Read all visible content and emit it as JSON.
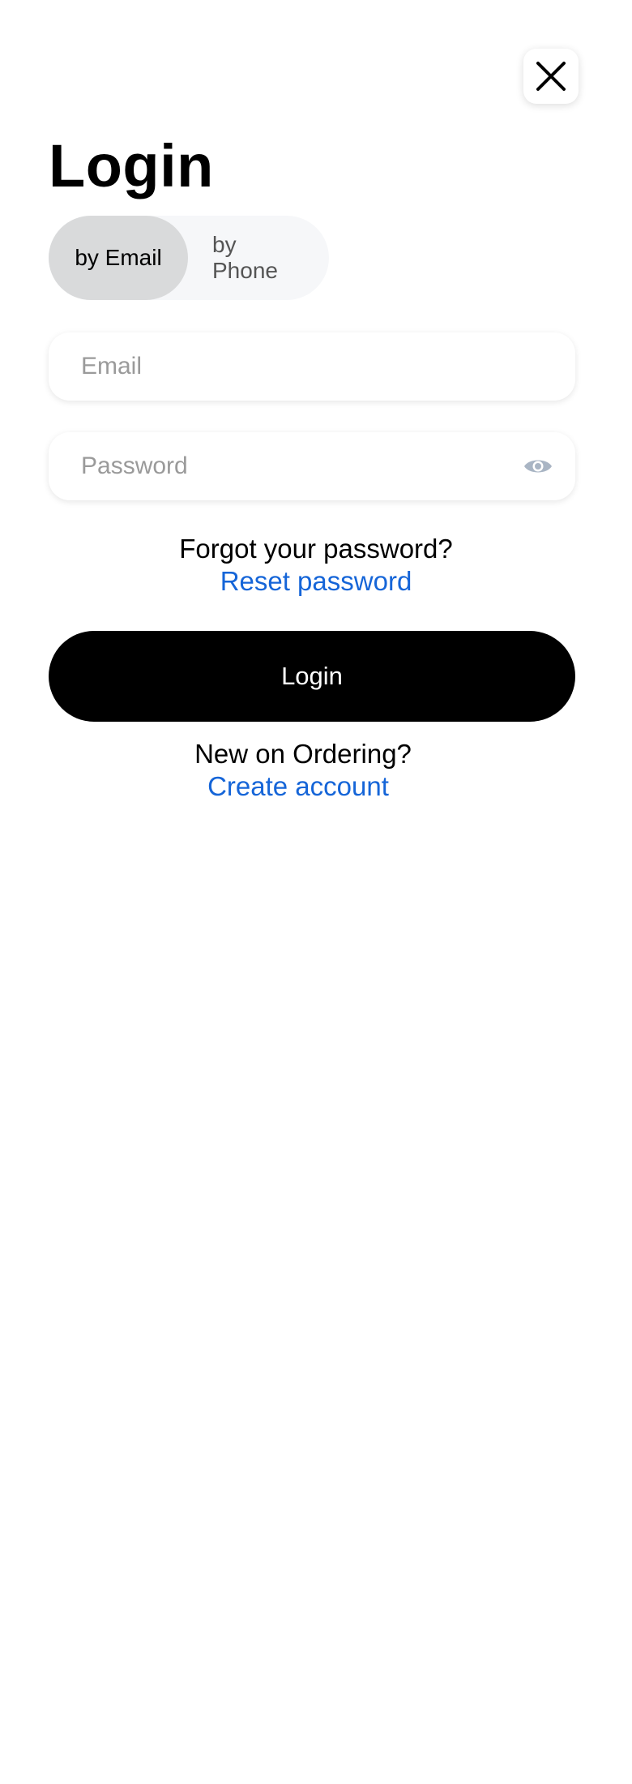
{
  "header": {
    "title": "Login",
    "close_icon": "close-icon"
  },
  "tabs": {
    "email_label": "by Email",
    "phone_label_line1": "by",
    "phone_label_line2": "Phone",
    "active": "by Email"
  },
  "form": {
    "email_placeholder": "Email",
    "email_value": "",
    "password_placeholder": "Password",
    "password_value": "",
    "password_toggle_icon": "eye-icon"
  },
  "forgot": {
    "prompt": "Forgot your password?",
    "link": "Reset password"
  },
  "login_button": {
    "label": "Login"
  },
  "signup": {
    "prompt": "New on Ordering?",
    "link": "Create account"
  },
  "colors": {
    "accent_link": "#1565d8",
    "primary_button": "#000000",
    "active_tab": "#d9dadb",
    "tab_track": "#f6f7f9"
  }
}
